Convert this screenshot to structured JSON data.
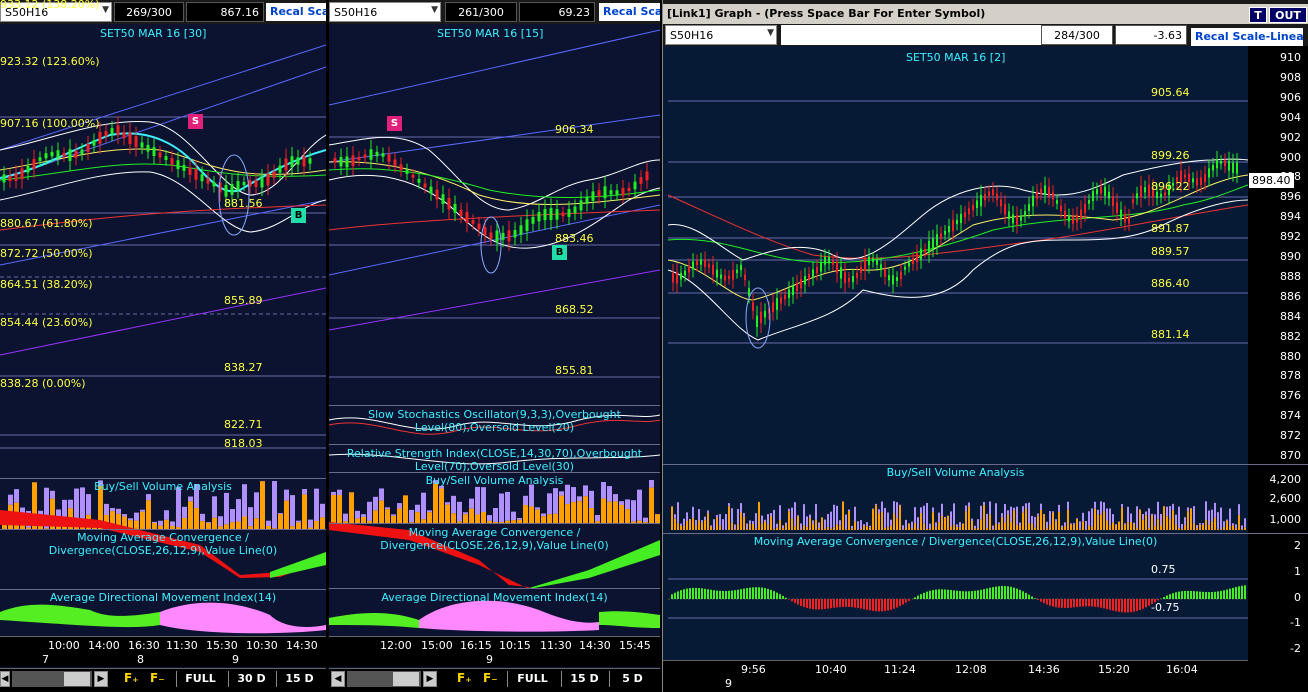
{
  "pane1": {
    "symbol": "S50H16",
    "count": "269/300",
    "value": "867.16",
    "recal": "Recal Scale",
    "title": "SET50 MAR 16  [30]",
    "fib_labels": [
      "923.32 (123.60%)",
      "907.16 (100.00%)",
      "880.67 (61.80%)",
      "872.72 (50.00%)",
      "864.51 (38.20%)",
      "854.44 (23.60%)",
      "838.28 (0.00%)"
    ],
    "top_partial": "933.12 (138.20%)",
    "price_labels": [
      "881.56",
      "855.89",
      "838.27",
      "822.71",
      "818.03"
    ],
    "marker_s": "S",
    "marker_b": "B",
    "volume_title": "Buy/Sell Volume Analysis",
    "macd_title": "Moving Average Convergence / Divergence(CLOSE,26,12,9),Value Line(0)",
    "adx_title": "Average Directional Movement Index(14)",
    "times": [
      "10:00",
      "14:00",
      "16:30",
      "11:30",
      "15:30",
      "10:30",
      "14:30"
    ],
    "days": [
      "7",
      "8",
      "9"
    ],
    "buttons": [
      "FULL",
      "30 D",
      "15 D"
    ]
  },
  "pane2": {
    "symbol": "S50H16",
    "count": "261/300",
    "value": "69.23",
    "recal": "Recal Scal",
    "title": "SET50 MAR 16  [15]",
    "price_labels": [
      "906.34",
      "883.46",
      "868.52",
      "855.81"
    ],
    "marker_s": "S",
    "marker_b": "B",
    "stoch_title": "Slow Stochastics Oscillator(9,3,3),Overbought Level(80),Oversold Level(20)",
    "rsi_title": "Relative Strength Index(CLOSE,14,30,70),Overbought Level(70),Oversold Level(30)",
    "volume_title": "Buy/Sell Volume Analysis",
    "macd_title": "Moving Average Convergence / Divergence(CLOSE,26,12,9),Value Line(0)",
    "adx_title": "Average Directional Movement Index(14)",
    "times": [
      "12:00",
      "15:00",
      "16:15",
      "10:15",
      "11:30",
      "14:30",
      "15:45"
    ],
    "days": [
      "9"
    ],
    "buttons": [
      "FULL",
      "15 D",
      "5 D"
    ]
  },
  "pane3": {
    "window_title": "[Link1] Graph  - (Press Space Bar For Enter Symbol)",
    "btn_t": "T",
    "btn_out": "OUT",
    "symbol": "S50H16",
    "count": "284/300",
    "value": "-3.63",
    "recal": "Recal Scale-Linear",
    "title": "SET50 MAR 16  [2]",
    "price_labels": [
      "905.64",
      "899.26",
      "896.22",
      "891.87",
      "889.57",
      "886.40",
      "881.14"
    ],
    "current_price": "898.40",
    "y_axis": [
      "910",
      "908",
      "906",
      "904",
      "902",
      "900",
      "898",
      "896",
      "894",
      "892",
      "890",
      "888",
      "886",
      "884",
      "882",
      "880",
      "878",
      "876",
      "874",
      "872",
      "870"
    ],
    "volume_title": "Buy/Sell Volume Analysis",
    "volume_axis": [
      "4,200",
      "2,600",
      "1,000"
    ],
    "macd_title": "Moving Average Convergence / Divergence(CLOSE,26,12,9),Value Line(0)",
    "macd_axis": [
      "2",
      "1",
      "0",
      "-1",
      "-2"
    ],
    "macd_levels": [
      "0.75",
      "-0.75"
    ],
    "times": [
      "9:56",
      "10:40",
      "11:24",
      "12:08",
      "14:36",
      "15:20",
      "16:04"
    ],
    "days": [
      "9"
    ]
  },
  "colors": {
    "bg": "#0b1330",
    "candle_up": "#22ee22",
    "candle_down": "#ee2222",
    "fib": "#ffff40",
    "title": "#3ef0ff",
    "vol_buy": "#b090ff",
    "vol_sell": "#ffa000"
  }
}
